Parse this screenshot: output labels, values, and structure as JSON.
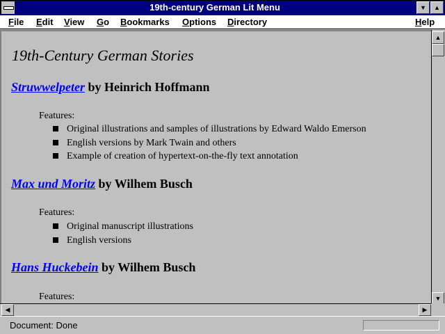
{
  "window": {
    "title": "19th-century German Lit Menu"
  },
  "menubar": {
    "items": [
      {
        "label": "File",
        "ul": "F",
        "rest": "ile"
      },
      {
        "label": "Edit",
        "ul": "E",
        "rest": "dit"
      },
      {
        "label": "View",
        "ul": "V",
        "rest": "iew"
      },
      {
        "label": "Go",
        "ul": "G",
        "rest": "o"
      },
      {
        "label": "Bookmarks",
        "ul": "B",
        "rest": "ookmarks"
      },
      {
        "label": "Options",
        "ul": "O",
        "rest": "ptions"
      },
      {
        "label": "Directory",
        "ul": "D",
        "rest": "irectory"
      },
      {
        "label": "Help",
        "ul": "H",
        "rest": "elp"
      }
    ]
  },
  "page": {
    "heading": "19th-Century German Stories",
    "stories": [
      {
        "title": "Struwwelpeter",
        "byline": " by Heinrich Hoffmann",
        "features_label": "Features:",
        "features": [
          "Original illustrations and samples of illustrations by Edward Waldo Emerson",
          "English versions by Mark Twain and others",
          "Example of creation of hypertext-on-the-fly text annotation"
        ]
      },
      {
        "title": "Max und Moritz",
        "byline": " by Wilhem Busch",
        "features_label": "Features:",
        "features": [
          "Original manuscript illustrations",
          "English versions"
        ]
      },
      {
        "title": "Hans Huckebein",
        "byline": " by Wilhem Busch",
        "features_label": "Features:",
        "features": []
      }
    ]
  },
  "status": {
    "text": "Document: Done"
  }
}
